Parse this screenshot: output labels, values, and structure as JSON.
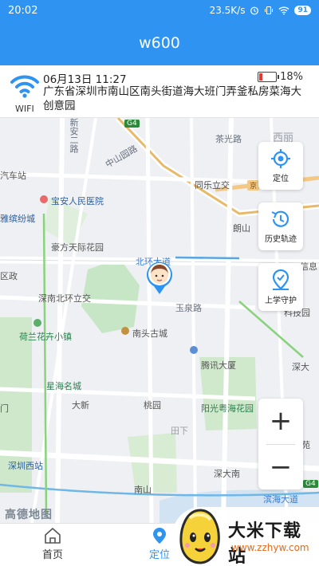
{
  "status_bar": {
    "time": "20:02",
    "network_speed": "23.5K/s",
    "battery_level": "91",
    "icons": [
      "alarm-icon",
      "vibrate-icon",
      "wifi-icon",
      "battery-icon"
    ]
  },
  "title": "w600",
  "device": {
    "connection_label": "WIFI",
    "datetime": "06月13日 11:27",
    "battery_percent": "18%",
    "battery_fraction": 0.18,
    "address": "广东省深圳市南山区南头街道海大班门弄釜私房菜海大创意园"
  },
  "map": {
    "labels": {
      "xindong": "新安二路",
      "g4": "G4",
      "chaguang": "茶光路",
      "xili": "西丽",
      "zhongshanyuan": "中山园路",
      "qichezhan": "汽车站",
      "tongle": "同乐立交",
      "jingzhan": "京",
      "baoan_hospital": "宝安人民医院",
      "yaxin": "雅缤纷城",
      "langshan": "朗山",
      "haopu": "豪方天际花园",
      "beihuan": "北环大道",
      "shenghuo": "信息",
      "quzheng": "区政",
      "shennan_beihuan": "深南北环立交",
      "yuquan": "玉泉路",
      "kejiyuan": "科技园",
      "helan": "荷兰花卉小镇",
      "nantou": "南头古城",
      "tengxun": "腾讯大厦",
      "shenda": "深大",
      "xinghai": "星海名城",
      "daxin": "大新",
      "taoyuan": "桃园",
      "yangguang": "阳光粤海花园",
      "men": "门",
      "tianxia": "田下",
      "yuan": "苑",
      "shenzhen_west": "深圳西站",
      "shendaxin": "深大南",
      "nanshan": "南山",
      "binhai": "滨海大道",
      "g4b": "G4"
    },
    "logo_text": "高德地图"
  },
  "buttons": {
    "locate": "定位",
    "history": "历史轨迹",
    "guard": "上学守护",
    "zoom_in": "+",
    "zoom_out": "−"
  },
  "tabs": [
    {
      "label": "首页",
      "icon": "home-icon",
      "active": false
    },
    {
      "label": "定位",
      "icon": "location-pin-icon",
      "active": true
    }
  ],
  "watermark": {
    "title": "大米下载站",
    "url": "www.zzhyw.com"
  },
  "colors": {
    "primary": "#2f93f2",
    "battery_low": "#e53935"
  }
}
